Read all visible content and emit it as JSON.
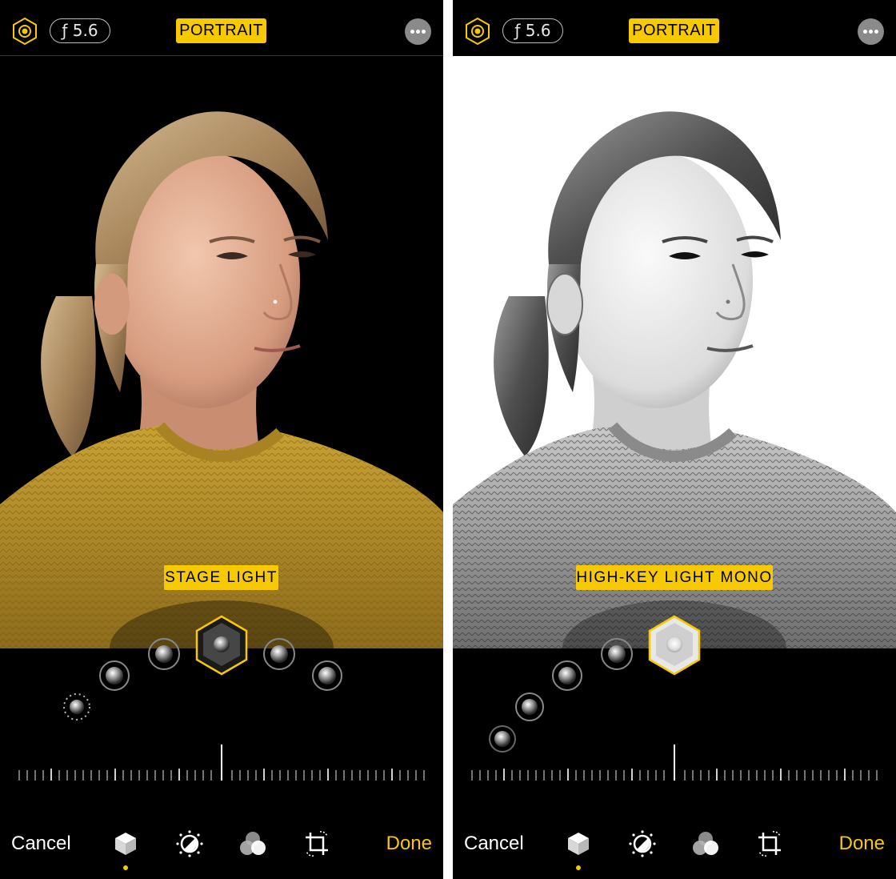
{
  "colors": {
    "accent": "#f7c900",
    "background": "#000000",
    "divider": "#ffffff"
  },
  "left_screen": {
    "aperture": "ƒ 5.6",
    "mode": "PORTRAIT",
    "effect_label": "STAGE LIGHT",
    "toolbar": {
      "cancel": "Cancel",
      "done": "Done",
      "tools": [
        "portrait-lighting-icon",
        "adjust-icon",
        "filters-icon",
        "crop-rotate-icon"
      ],
      "selected_tool": "portrait-lighting-icon"
    }
  },
  "right_screen": {
    "aperture": "ƒ 5.6",
    "mode": "PORTRAIT",
    "effect_label": "HIGH-KEY LIGHT MONO",
    "toolbar": {
      "cancel": "Cancel",
      "done": "Done",
      "tools": [
        "portrait-lighting-icon",
        "adjust-icon",
        "filters-icon",
        "crop-rotate-icon"
      ],
      "selected_tool": "portrait-lighting-icon"
    }
  }
}
